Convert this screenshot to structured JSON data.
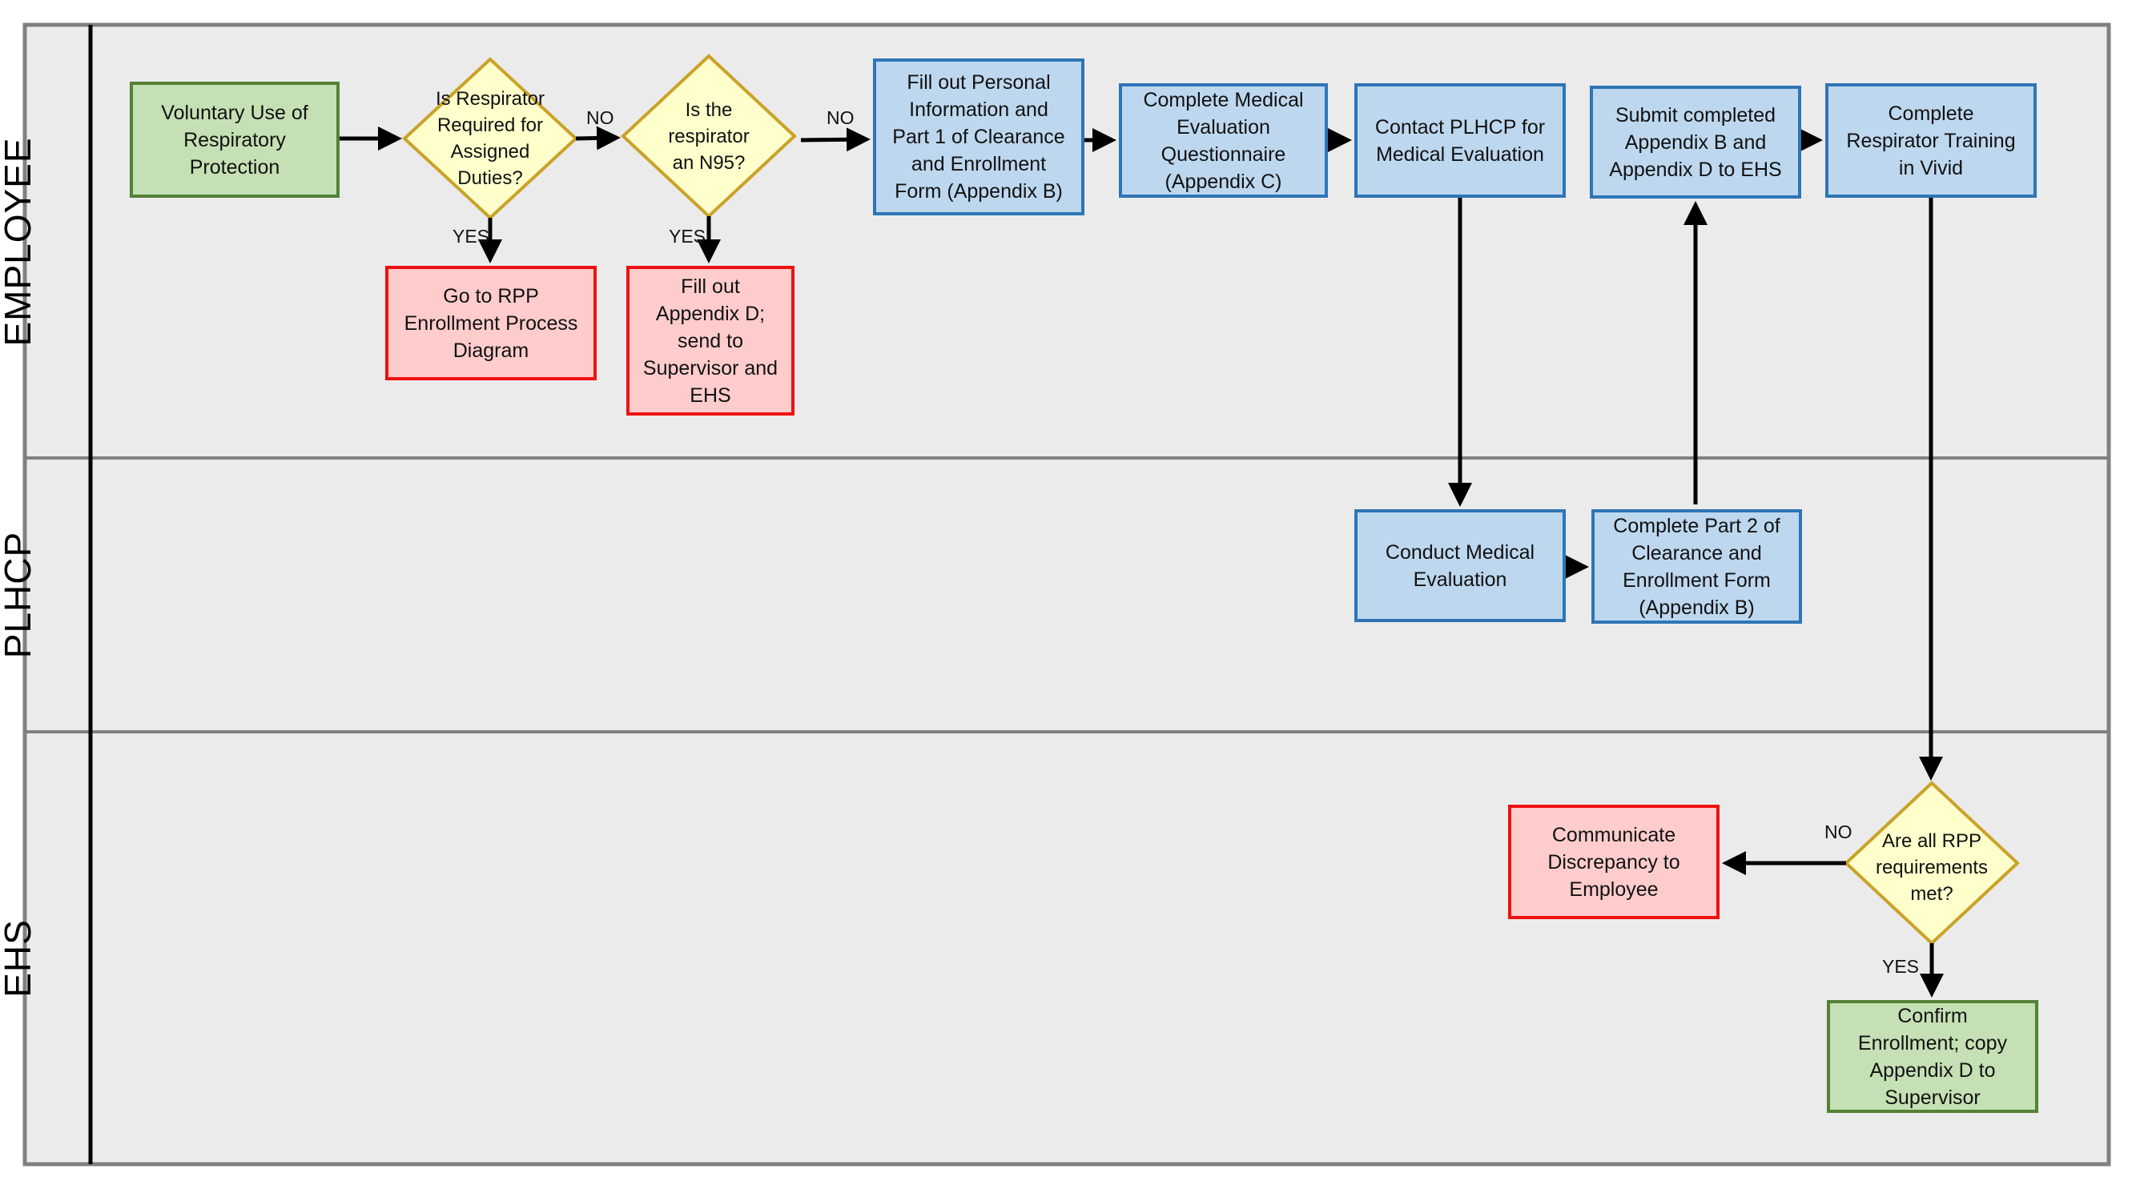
{
  "lanes": [
    {
      "label": "EMPLOYEE"
    },
    {
      "label": "PLHCP"
    },
    {
      "label": "EHS"
    }
  ],
  "colors": {
    "lane_background": "#ebebeb",
    "lane_border": "#808080",
    "start_end_fill": "#c5e0b4",
    "start_end_border": "#548235",
    "process_fill": "#bdd7ee",
    "process_border": "#2e75b6",
    "terminal_fill": "#ffcccc",
    "terminal_border": "#ee1111",
    "decision_fill": "#ffffcc",
    "decision_border": "#c9a227",
    "arrow": "#000000"
  },
  "nodes": {
    "voluntary_use": "Voluntary Use of\nRespiratory\nProtection",
    "decision_required": "Is Respirator\nRequired for\nAssigned\nDuties?",
    "decision_n95": "Is the\nrespirator\nan N95?",
    "go_to_rpp": "Go to RPP\nEnrollment Process\nDiagram",
    "fill_out_appendix_d": "Fill out\nAppendix D;\nsend to\nSupervisor and\nEHS",
    "fill_out_personal": "Fill out Personal\nInformation and\nPart 1 of  Clearance\nand Enrollment\nForm (Appendix B)",
    "complete_questionnaire": "Complete Medical\nEvaluation\nQuestionnaire\n(Appendix C)",
    "contact_plhcp": "Contact PLHCP for\nMedical Evaluation",
    "submit_completed": "Submit completed\nAppendix B and\nAppendix D to EHS",
    "complete_training": "Complete\nRespirator Training\nin Vivid",
    "conduct_medical": "Conduct Medical\nEvaluation",
    "complete_part2": "Complete Part 2 of\nClearance and\nEnrollment Form\n(Appendix B)",
    "decision_requirements": "Are all RPP\nrequirements\nmet?",
    "communicate_discrepancy": "Communicate\nDiscrepancy to\nEmployee",
    "confirm_enrollment": "Confirm\nEnrollment; copy\nAppendix D to\nSupervisor"
  },
  "edge_labels": {
    "required_no": "NO",
    "required_yes": "YES",
    "n95_no": "NO",
    "n95_yes": "YES",
    "requirements_no": "NO",
    "requirements_yes": "YES"
  }
}
